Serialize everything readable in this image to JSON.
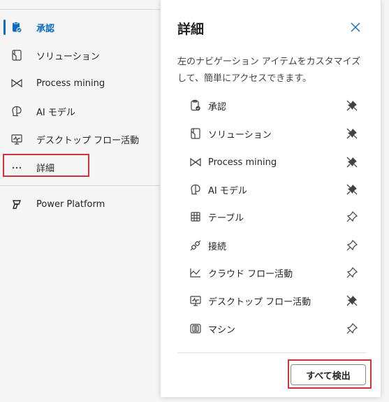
{
  "nav": {
    "items": [
      {
        "label": "承認",
        "icon": "approvals-icon"
      },
      {
        "label": "ソリューション",
        "icon": "solutions-icon"
      },
      {
        "label": "Process mining",
        "icon": "process-mining-icon"
      },
      {
        "label": "AI モデル",
        "icon": "ai-model-icon"
      },
      {
        "label": "デスクトップ フロー活動",
        "icon": "desktop-flow-activity-icon"
      },
      {
        "label": "詳細",
        "icon": "more-icon"
      }
    ],
    "footer_label": "Power Platform",
    "selected_color": "#0f6cbd"
  },
  "panel": {
    "title": "詳細",
    "description": "左のナビゲーション アイテムをカスタマイズして、簡単にアクセスできます。",
    "items": [
      {
        "label": "承認",
        "icon": "approvals-icon",
        "pinned": true
      },
      {
        "label": "ソリューション",
        "icon": "solutions-icon",
        "pinned": true
      },
      {
        "label": "Process mining",
        "icon": "process-mining-icon",
        "pinned": true
      },
      {
        "label": "AI モデル",
        "icon": "ai-model-icon",
        "pinned": true
      },
      {
        "label": "テーブル",
        "icon": "table-icon",
        "pinned": false
      },
      {
        "label": "接続",
        "icon": "connections-icon",
        "pinned": false
      },
      {
        "label": "クラウド フロー活動",
        "icon": "cloud-flow-activity-icon",
        "pinned": false
      },
      {
        "label": "デスクトップ フロー活動",
        "icon": "desktop-flow-activity-icon",
        "pinned": true
      },
      {
        "label": "マシン",
        "icon": "machines-icon",
        "pinned": false
      }
    ],
    "discover_all_label": "すべて検出"
  },
  "highlight_color": "#d13438"
}
